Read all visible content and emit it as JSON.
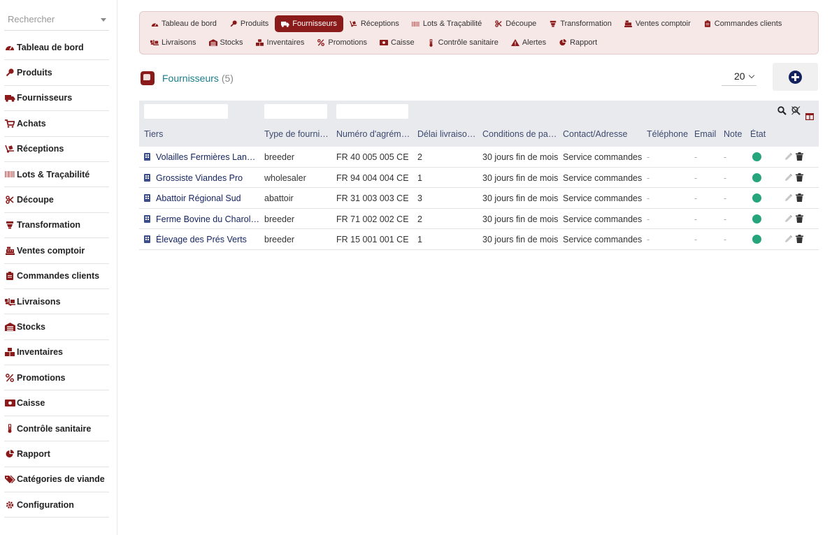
{
  "search": {
    "placeholder": "Rechercher"
  },
  "sidebar": {
    "items": [
      {
        "label": "Tableau de bord",
        "icon": "gauge-icon"
      },
      {
        "label": "Produits",
        "icon": "drumstick-icon"
      },
      {
        "label": "Fournisseurs",
        "icon": "truck-icon"
      },
      {
        "label": "Achats",
        "icon": "cart-icon"
      },
      {
        "label": "Réceptions",
        "icon": "dolly-icon"
      },
      {
        "label": "Lots & Traçabilité",
        "icon": "barcode-icon"
      },
      {
        "label": "Découpe",
        "icon": "scissors-icon"
      },
      {
        "label": "Transformation",
        "icon": "mortar-icon"
      },
      {
        "label": "Ventes comptoir",
        "icon": "cash-register-icon"
      },
      {
        "label": "Commandes clients",
        "icon": "clipboard-icon"
      },
      {
        "label": "Livraisons",
        "icon": "truck-loading-icon"
      },
      {
        "label": "Stocks",
        "icon": "warehouse-icon"
      },
      {
        "label": "Inventaires",
        "icon": "boxes-icon"
      },
      {
        "label": "Promotions",
        "icon": "percent-icon"
      },
      {
        "label": "Caisse",
        "icon": "money-bill-icon"
      },
      {
        "label": "Contrôle sanitaire",
        "icon": "thermometer-icon"
      },
      {
        "label": "Rapport",
        "icon": "pie-chart-icon"
      },
      {
        "label": "Catégories de viande",
        "icon": "tags-icon"
      },
      {
        "label": "Configuration",
        "icon": "cog-icon"
      }
    ]
  },
  "topmenu": {
    "row1": [
      {
        "label": "Tableau de bord",
        "icon": "gauge-icon",
        "active": false
      },
      {
        "label": "Produits",
        "icon": "drumstick-icon",
        "active": false
      },
      {
        "label": "Fournisseurs",
        "icon": "truck-icon",
        "active": true
      },
      {
        "label": "Réceptions",
        "icon": "dolly-icon",
        "active": false
      },
      {
        "label": "Lots & Traçabilité",
        "icon": "barcode-icon",
        "active": false
      },
      {
        "label": "Découpe",
        "icon": "scissors-icon",
        "active": false
      },
      {
        "label": "Transformation",
        "icon": "mortar-icon",
        "active": false
      },
      {
        "label": "Ventes comptoir",
        "icon": "cash-register-icon",
        "active": false
      },
      {
        "label": "Commandes clients",
        "icon": "clipboard-icon",
        "active": false
      }
    ],
    "row2": [
      {
        "label": "Livraisons",
        "icon": "truck-loading-icon",
        "active": false
      },
      {
        "label": "Stocks",
        "icon": "warehouse-icon",
        "active": false
      },
      {
        "label": "Inventaires",
        "icon": "boxes-icon",
        "active": false
      },
      {
        "label": "Promotions",
        "icon": "percent-icon",
        "active": false
      },
      {
        "label": "Caisse",
        "icon": "money-bill-icon",
        "active": false
      },
      {
        "label": "Contrôle sanitaire",
        "icon": "thermometer-icon",
        "active": false
      },
      {
        "label": "Alertes",
        "icon": "warning-icon",
        "active": false
      },
      {
        "label": "Rapport",
        "icon": "pie-chart-icon",
        "active": false
      }
    ]
  },
  "page": {
    "title": "Fournisseurs",
    "count": "(5)",
    "page_size": "20"
  },
  "table": {
    "columns": [
      "Tiers",
      "Type de fourni…",
      "Numéro d'agrém…",
      "Délai livraiso…",
      "Conditions de pa…",
      "Contact/Adresse",
      "Téléphone",
      "Email",
      "Note",
      "État"
    ],
    "rows": [
      {
        "tiers": "Volailles Fermières Landes",
        "type": "breeder",
        "agrement": "FR 40 005 005 CE",
        "delai": "2",
        "conditions": "30 jours fin de mois",
        "contact": "Service commandes",
        "telephone": "-",
        "email": "-",
        "note": "-"
      },
      {
        "tiers": "Grossiste Viandes Pro",
        "type": "wholesaler",
        "agrement": "FR 94 004 004 CE",
        "delai": "1",
        "conditions": "30 jours fin de mois",
        "contact": "Service commandes",
        "telephone": "-",
        "email": "-",
        "note": "-"
      },
      {
        "tiers": "Abattoir Régional Sud",
        "type": "abattoir",
        "agrement": "FR 31 003 003 CE",
        "delai": "3",
        "conditions": "30 jours fin de mois",
        "contact": "Service commandes",
        "telephone": "-",
        "email": "-",
        "note": "-"
      },
      {
        "tiers": "Ferme Bovine du Charol…",
        "type": "breeder",
        "agrement": "FR 71 002 002 CE",
        "delai": "2",
        "conditions": "30 jours fin de mois",
        "contact": "Service commandes",
        "telephone": "-",
        "email": "-",
        "note": "-"
      },
      {
        "tiers": "Élevage des Prés Verts",
        "type": "breeder",
        "agrement": "FR 15 001 001 CE",
        "delai": "1",
        "conditions": "30 jours fin de mois",
        "contact": "Service commandes",
        "telephone": "-",
        "email": "-",
        "note": "-"
      }
    ]
  },
  "colors": {
    "accent": "#8b1a1a",
    "link": "#14235f",
    "title": "#1a7d8c",
    "status_ok": "#26a57c"
  }
}
